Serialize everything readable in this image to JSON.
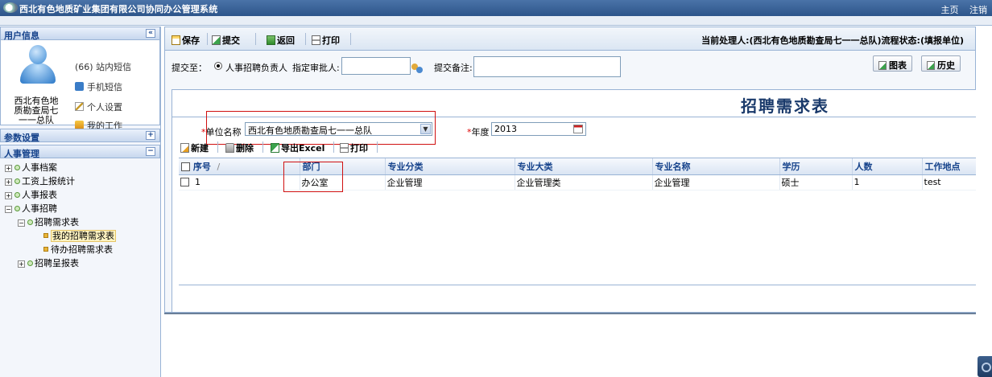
{
  "app": {
    "title": "西北有色地质矿业集团有限公司协同办公管理系统",
    "home": "主页",
    "logout": "注销"
  },
  "sidebar": {
    "user_header": "用户信息",
    "collapse_glyph": "«",
    "user_name": "西北有色地质勘查局七一一总队",
    "messages": "(66) 站内短信",
    "sms": "手机短信",
    "personal_settings": "个人设置",
    "my_work": "我的工作",
    "param_header": "参数设置",
    "hr_header": "人事管理",
    "expand_glyph": "+",
    "collapse_glyph2": "−",
    "tree": {
      "archives": "人事档案",
      "salary": "工资上报统计",
      "reports": "人事报表",
      "recruit": "人事招聘",
      "demand": "招聘需求表",
      "my_demand": "我的招聘需求表",
      "todo_demand": "待办招聘需求表",
      "recruit_report": "招聘呈报表"
    }
  },
  "toolbar": {
    "save": "保存",
    "submit": "提交",
    "back": "返回",
    "print": "打印",
    "current_info": "当前处理人:(西北有色地质勘查局七一一总队)流程状态:(填报单位)"
  },
  "submit_row": {
    "submit_to": "提交至：",
    "radio_option": "人事招聘负责人",
    "approver_label": "指定审批人:",
    "approver_value": "",
    "note_label": "提交备注:",
    "note_value": "",
    "chart_btn": "图表",
    "history_btn": "历史"
  },
  "form": {
    "title": "招聘需求表",
    "unit_label": "单位名称",
    "unit_value": "西北有色地质勘查局七一一总队",
    "year_label": "年度",
    "year_value": "2013",
    "req_mark": "*"
  },
  "grid_toolbar": {
    "new": "新建",
    "delete": "删除",
    "export": "导出Excel",
    "print": "打印"
  },
  "grid": {
    "columns": [
      "序号",
      "部门",
      "专业分类",
      "专业大类",
      "专业名称",
      "学历",
      "人数",
      "工作地点"
    ],
    "sort_glyph": "/",
    "rows": [
      [
        "1",
        "办公室",
        "企业管理",
        "企业管理类",
        "企业管理",
        "硕士",
        "1",
        "test"
      ]
    ]
  },
  "colors": {
    "topbar": "#2d558a",
    "panel_border": "#99b3d5",
    "header_text": "#15428b",
    "highlight_box": "#d01010"
  }
}
